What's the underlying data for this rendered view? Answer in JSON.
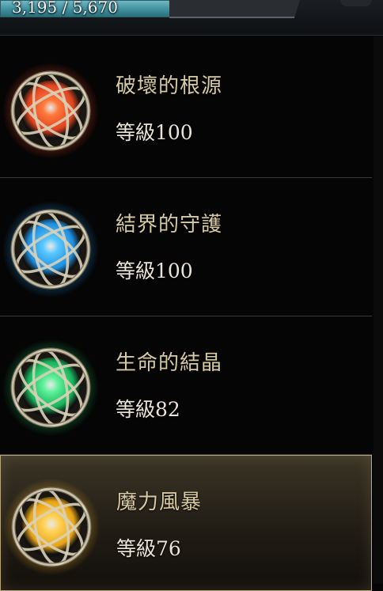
{
  "header": {
    "exp_text": "3,195 / 5,670"
  },
  "crystals": [
    {
      "name": "破壞的根源",
      "level": "等級100",
      "color": "#e0431f",
      "glow": "#ff7a3c",
      "icon": "red-crystal-orb-icon"
    },
    {
      "name": "結界的守護",
      "level": "等級100",
      "color": "#1f8fe0",
      "glow": "#59c8ff",
      "icon": "blue-crystal-orb-icon"
    },
    {
      "name": "生命的結晶",
      "level": "等級82",
      "color": "#18b25a",
      "glow": "#5ff29a",
      "icon": "green-crystal-orb-icon"
    },
    {
      "name": "魔力風暴",
      "level": "等級76",
      "color": "#e7a316",
      "glow": "#ffd35a",
      "icon": "gold-crystal-orb-icon"
    }
  ],
  "selected_index": 3
}
